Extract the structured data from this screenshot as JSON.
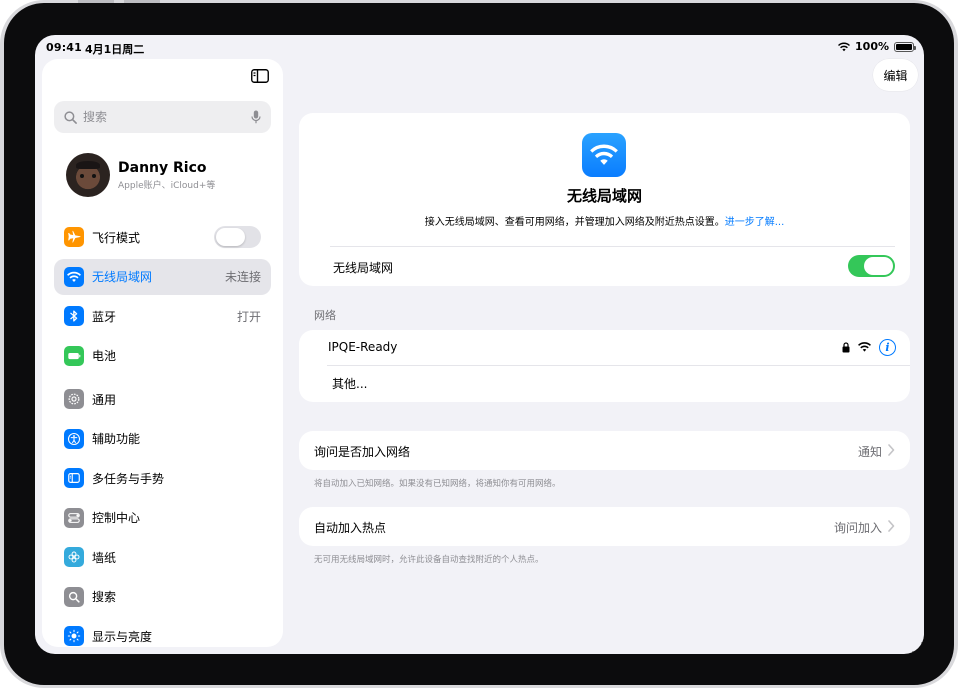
{
  "status": {
    "time": "09:41",
    "date": "4月1日周二",
    "battery": "100%"
  },
  "sidebar": {
    "search_placeholder": "搜索",
    "profile": {
      "name": "Danny Rico",
      "subtitle": "Apple账户、iCloud+等"
    },
    "group1": [
      {
        "label": "飞行模式",
        "icon": "airplane-icon",
        "color": "#ff9500",
        "value": "",
        "toggle": true
      },
      {
        "label": "无线局域网",
        "icon": "wifi-icon",
        "color": "#007aff",
        "value": "未连接",
        "active": true
      },
      {
        "label": "蓝牙",
        "icon": "bluetooth-icon",
        "color": "#007aff",
        "value": "打开"
      },
      {
        "label": "电池",
        "icon": "battery-icon",
        "color": "#34c759",
        "value": ""
      }
    ],
    "group2": [
      {
        "label": "通用",
        "icon": "gear-icon",
        "color": "#8e8e93"
      },
      {
        "label": "辅助功能",
        "icon": "accessibility-icon",
        "color": "#007aff"
      },
      {
        "label": "多任务与手势",
        "icon": "multitasking-icon",
        "color": "#007aff"
      },
      {
        "label": "控制中心",
        "icon": "control-center-icon",
        "color": "#8e8e93"
      },
      {
        "label": "墙纸",
        "icon": "wallpaper-icon",
        "color": "#34aadc"
      },
      {
        "label": "搜索",
        "icon": "search-icon",
        "color": "#8e8e93"
      },
      {
        "label": "显示与亮度",
        "icon": "brightness-icon",
        "color": "#007aff"
      }
    ]
  },
  "main": {
    "edit_label": "编辑",
    "hero": {
      "title": "无线局域网",
      "description": "接入无线局域网、查看可用网络，并管理加入网络及附近热点设置。",
      "link": "进一步了解...",
      "toggle_label": "无线局域网"
    },
    "networks_header": "网络",
    "networks": [
      {
        "name": "IPQE-Ready"
      }
    ],
    "other_label": "其他...",
    "ask_join": {
      "label": "询问是否加入网络",
      "value": "通知",
      "footnote": "将自动加入已知网络。如果没有已知网络，将通知你有可用网络。"
    },
    "auto_hotspot": {
      "label": "自动加入热点",
      "value": "询问加入",
      "footnote": "无可用无线局域网时，允许此设备自动查找附近的个人热点。"
    }
  }
}
